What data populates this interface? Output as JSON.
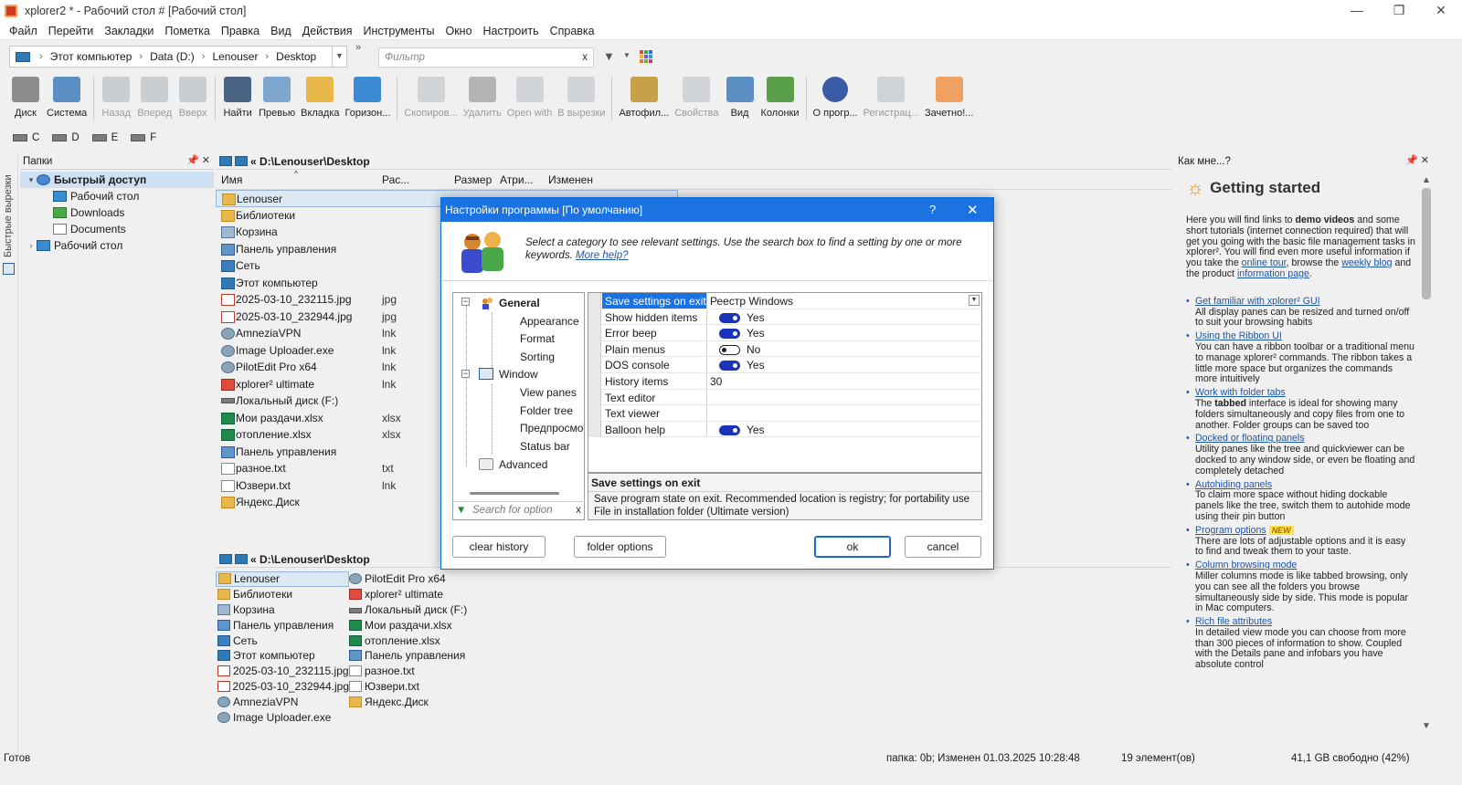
{
  "window": {
    "title": "xplorer2 * - Рабочий стол # [Рабочий стол]",
    "controls": [
      "—",
      "❐",
      "✕"
    ]
  },
  "menu": [
    "Файл",
    "Перейти",
    "Закладки",
    "Пометка",
    "Правка",
    "Вид",
    "Действия",
    "Инструменты",
    "Окно",
    "Настроить",
    "Справка"
  ],
  "address": {
    "crumbs": [
      "Этот компьютер",
      "Data (D:)",
      "Lenouser",
      "Desktop"
    ],
    "filter_placeholder": "Фильтр",
    "filter_clear": "x"
  },
  "toolbar": [
    {
      "label": "Диск",
      "icon": "disk-icon",
      "enabled": true
    },
    {
      "label": "Система",
      "icon": "computer-icon",
      "enabled": true
    },
    {
      "label": "Назад",
      "icon": "back-arrow-icon",
      "enabled": false
    },
    {
      "label": "Вперед",
      "icon": "forward-arrow-icon",
      "enabled": false
    },
    {
      "label": "Вверх",
      "icon": "up-folder-icon",
      "enabled": false
    },
    {
      "label": "Найти",
      "icon": "binoculars-icon",
      "enabled": true
    },
    {
      "label": "Превью",
      "icon": "preview-icon",
      "enabled": true
    },
    {
      "label": "Вкладка",
      "icon": "folder-tab-icon",
      "enabled": true
    },
    {
      "label": "Горизон...",
      "icon": "horizontal-pane-icon",
      "enabled": true
    },
    {
      "label": "Скопиров...",
      "icon": "copy-icon",
      "enabled": false
    },
    {
      "label": "Удалить",
      "icon": "delete-x-icon",
      "enabled": false
    },
    {
      "label": "Open with",
      "icon": "open-with-icon",
      "enabled": false
    },
    {
      "label": "В вырезки",
      "icon": "scrap-icon",
      "enabled": false
    },
    {
      "label": "Автофил...",
      "icon": "autofilter-icon",
      "enabled": true
    },
    {
      "label": "Свойства",
      "icon": "properties-icon",
      "enabled": false
    },
    {
      "label": "Вид",
      "icon": "view-icon",
      "enabled": true
    },
    {
      "label": "Колонки",
      "icon": "columns-icon",
      "enabled": true
    },
    {
      "label": "О прогр...",
      "icon": "help-question-icon",
      "enabled": true
    },
    {
      "label": "Регистрац...",
      "icon": "register-icon",
      "enabled": false
    },
    {
      "label": "Зачетно!...",
      "icon": "thumbs-up-icon",
      "enabled": true
    }
  ],
  "drives": [
    "C",
    "D",
    "E",
    "F"
  ],
  "strip_label": "Быстрые вырезки",
  "tree": {
    "header": "Папки",
    "items": [
      {
        "label": "Быстрый доступ",
        "level": 0,
        "bold": true,
        "selected": true,
        "icon": "star-icon"
      },
      {
        "label": "Рабочий стол",
        "level": 1,
        "icon": "desktop-icon"
      },
      {
        "label": "Downloads",
        "level": 1,
        "icon": "download-icon"
      },
      {
        "label": "Documents",
        "level": 1,
        "icon": "document-icon"
      },
      {
        "label": "Рабочий стол",
        "level": 0,
        "icon": "desktop-icon"
      }
    ]
  },
  "filepane": {
    "path": "« D:\\Lenouser\\Desktop",
    "columns": [
      "Имя",
      "Рас...",
      "Размер",
      "Атри...",
      "Изменен"
    ],
    "rows": [
      {
        "name": "Lenouser",
        "ext": "",
        "icon": "folder-icon",
        "selected": true
      },
      {
        "name": "Библиотеки",
        "ext": "",
        "icon": "folder-icon"
      },
      {
        "name": "Корзина",
        "ext": "",
        "icon": "recycle-bin-icon"
      },
      {
        "name": "Панель управления",
        "ext": "",
        "icon": "control-panel-icon"
      },
      {
        "name": "Сеть",
        "ext": "",
        "icon": "network-icon"
      },
      {
        "name": "Этот компьютер",
        "ext": "",
        "icon": "computer-icon"
      },
      {
        "name": "2025-03-10_232115.jpg",
        "ext": "jpg",
        "icon": "jpg-icon"
      },
      {
        "name": "2025-03-10_232944.jpg",
        "ext": "jpg",
        "icon": "jpg-icon"
      },
      {
        "name": "AmneziaVPN",
        "ext": "lnk",
        "icon": "app-icon"
      },
      {
        "name": "Image Uploader.exe",
        "ext": "lnk",
        "icon": "app-icon"
      },
      {
        "name": "PilotEdit Pro x64",
        "ext": "lnk",
        "icon": "app-icon"
      },
      {
        "name": "xplorer² ultimate",
        "ext": "lnk",
        "icon": "xplorer-icon"
      },
      {
        "name": "Локальный диск (F:)",
        "ext": "",
        "icon": "drive-icon"
      },
      {
        "name": "Мои раздачи.xlsx",
        "ext": "xlsx",
        "icon": "excel-icon"
      },
      {
        "name": "отопление.xlsx",
        "ext": "xlsx",
        "icon": "excel-icon"
      },
      {
        "name": "Панель управления",
        "ext": "",
        "icon": "control-panel-icon"
      },
      {
        "name": "разное.txt",
        "ext": "txt",
        "icon": "text-file-icon"
      },
      {
        "name": "Юзвери.txt",
        "ext": "lnk",
        "icon": "text-file-icon"
      },
      {
        "name": "Яндекс.Диск",
        "ext": "",
        "icon": "folder-icon"
      }
    ]
  },
  "filepane2": {
    "path": "« D:\\Lenouser\\Desktop",
    "col1": [
      {
        "name": "Lenouser",
        "icon": "folder-icon",
        "selected": true
      },
      {
        "name": "Библиотеки",
        "icon": "folder-icon"
      },
      {
        "name": "Корзина",
        "icon": "recycle-bin-icon"
      },
      {
        "name": "Панель управления",
        "icon": "control-panel-icon"
      },
      {
        "name": "Сеть",
        "icon": "network-icon"
      },
      {
        "name": "Этот компьютер",
        "icon": "computer-icon"
      },
      {
        "name": "2025-03-10_232115.jpg",
        "icon": "jpg-icon"
      },
      {
        "name": "2025-03-10_232944.jpg",
        "icon": "jpg-icon"
      },
      {
        "name": "AmneziaVPN",
        "icon": "app-icon"
      },
      {
        "name": "Image Uploader.exe",
        "icon": "app-icon"
      }
    ],
    "col2": [
      {
        "name": "PilotEdit Pro x64",
        "icon": "app-icon"
      },
      {
        "name": "xplorer² ultimate",
        "icon": "xplorer-icon"
      },
      {
        "name": "Локальный диск (F:)",
        "icon": "drive-icon"
      },
      {
        "name": "Мои раздачи.xlsx",
        "icon": "excel-icon"
      },
      {
        "name": "отопление.xlsx",
        "icon": "excel-icon"
      },
      {
        "name": "Панель управления",
        "icon": "control-panel-icon"
      },
      {
        "name": "разное.txt",
        "icon": "text-file-icon"
      },
      {
        "name": "Юзвери.txt",
        "icon": "text-file-icon"
      },
      {
        "name": "Яндекс.Диск",
        "icon": "folder-icon"
      }
    ]
  },
  "help": {
    "header": "Как мне...?",
    "title": "Getting started",
    "intro_1": "Here you will find links to ",
    "intro_bold": "demo videos",
    "intro_2": " and some short tutorials (internet connection required) that will get you going with the basic file management tasks in xplorer². You will find even more useful information if you take the ",
    "link_tour": "online tour",
    "intro_3": ", browse the ",
    "link_blog": "weekly blog",
    "intro_4": " and the product ",
    "link_info": "information page",
    "intro_5": ".",
    "items": [
      {
        "link": "Get familiar with xplorer² GUI",
        "text": "All display panes can be resized and turned on/off to suit your browsing habits"
      },
      {
        "link": "Using the Ribbon UI",
        "text": "You can have a ribbon toolbar or a traditional menu to manage xplorer² commands. The ribbon takes a little more space but organizes the commands more intuitively"
      },
      {
        "link": "Work with folder tabs",
        "text_pre": "The ",
        "text_bold": "tabbed",
        "text": " interface is ideal for showing many folders simultaneously and copy files from one to another. Folder groups can be saved too"
      },
      {
        "link": "Docked or floating panels",
        "text": "Utility panes like the tree and quickviewer can be docked to any window side, or even be floating and completely detached"
      },
      {
        "link": "Autohiding panels",
        "text": "To claim more space without hiding dockable panels like the tree, switch them to autohide mode using their pin button"
      },
      {
        "link": "Program options",
        "badge": "NEW",
        "text": "There are lots of adjustable options and it is easy to find and tweak them to your taste."
      },
      {
        "link": "Column browsing mode",
        "text": "Miller columns mode is like tabbed browsing, only you can see all the folders you browse simultaneously side by side. This mode is popular in Mac computers."
      },
      {
        "link": "Rich file attributes",
        "text": "In detailed view mode you can choose from more than 300 pieces of information to show. Coupled with the Details pane and infobars you have absolute control"
      }
    ]
  },
  "status": {
    "ready": "Готов",
    "info": "папка: 0b; Изменен 01.03.2025 10:28:48",
    "count": "19 элемент(ов)",
    "free": "41,1 GB свободно (42%)"
  },
  "dialog": {
    "title": "Настройки программы [По умолчанию]",
    "help_btn": "?",
    "close_btn": "✕",
    "intro": "Select a category to see relevant settings. Use the search box to find a setting by one or more keywords.",
    "intro_link": "More help?",
    "categories": [
      {
        "label": "General",
        "bold": true
      },
      {
        "label": "Appearance"
      },
      {
        "label": "Format"
      },
      {
        "label": "Sorting"
      },
      {
        "label": "Window"
      },
      {
        "label": "View panes"
      },
      {
        "label": "Folder tree"
      },
      {
        "label": "Предпросмо"
      },
      {
        "label": "Status bar"
      },
      {
        "label": "Advanced"
      }
    ],
    "search_placeholder": "Search for option",
    "search_clear": "x",
    "options": [
      {
        "name": "Save settings on exit",
        "type": "select",
        "value": "Реестр Windows",
        "selected": true
      },
      {
        "name": "Show hidden items",
        "type": "toggle",
        "on": true,
        "value": "Yes"
      },
      {
        "name": "Error beep",
        "type": "toggle",
        "on": true,
        "value": "Yes"
      },
      {
        "name": "Plain menus",
        "type": "toggle",
        "on": false,
        "value": "No"
      },
      {
        "name": "DOS console",
        "type": "toggle",
        "on": true,
        "value": "Yes"
      },
      {
        "name": "History items",
        "type": "text",
        "value": "30"
      },
      {
        "name": "Text editor",
        "type": "text",
        "value": ""
      },
      {
        "name": "Text viewer",
        "type": "text",
        "value": ""
      },
      {
        "name": "Balloon help",
        "type": "toggle",
        "on": true,
        "value": "Yes"
      }
    ],
    "desc_title": "Save settings on exit",
    "desc_text": "Save program state on exit. Recommended location is registry; for portability use File in installation folder (Ultimate version)",
    "buttons": {
      "clear_history": "clear history",
      "folder_options": "folder options",
      "ok": "ok",
      "cancel": "cancel"
    }
  },
  "colors": {
    "accent": "#1a73e0",
    "toggle_on": "#1a33b8",
    "link": "#1f57a6",
    "folder": "#e8b84a"
  }
}
